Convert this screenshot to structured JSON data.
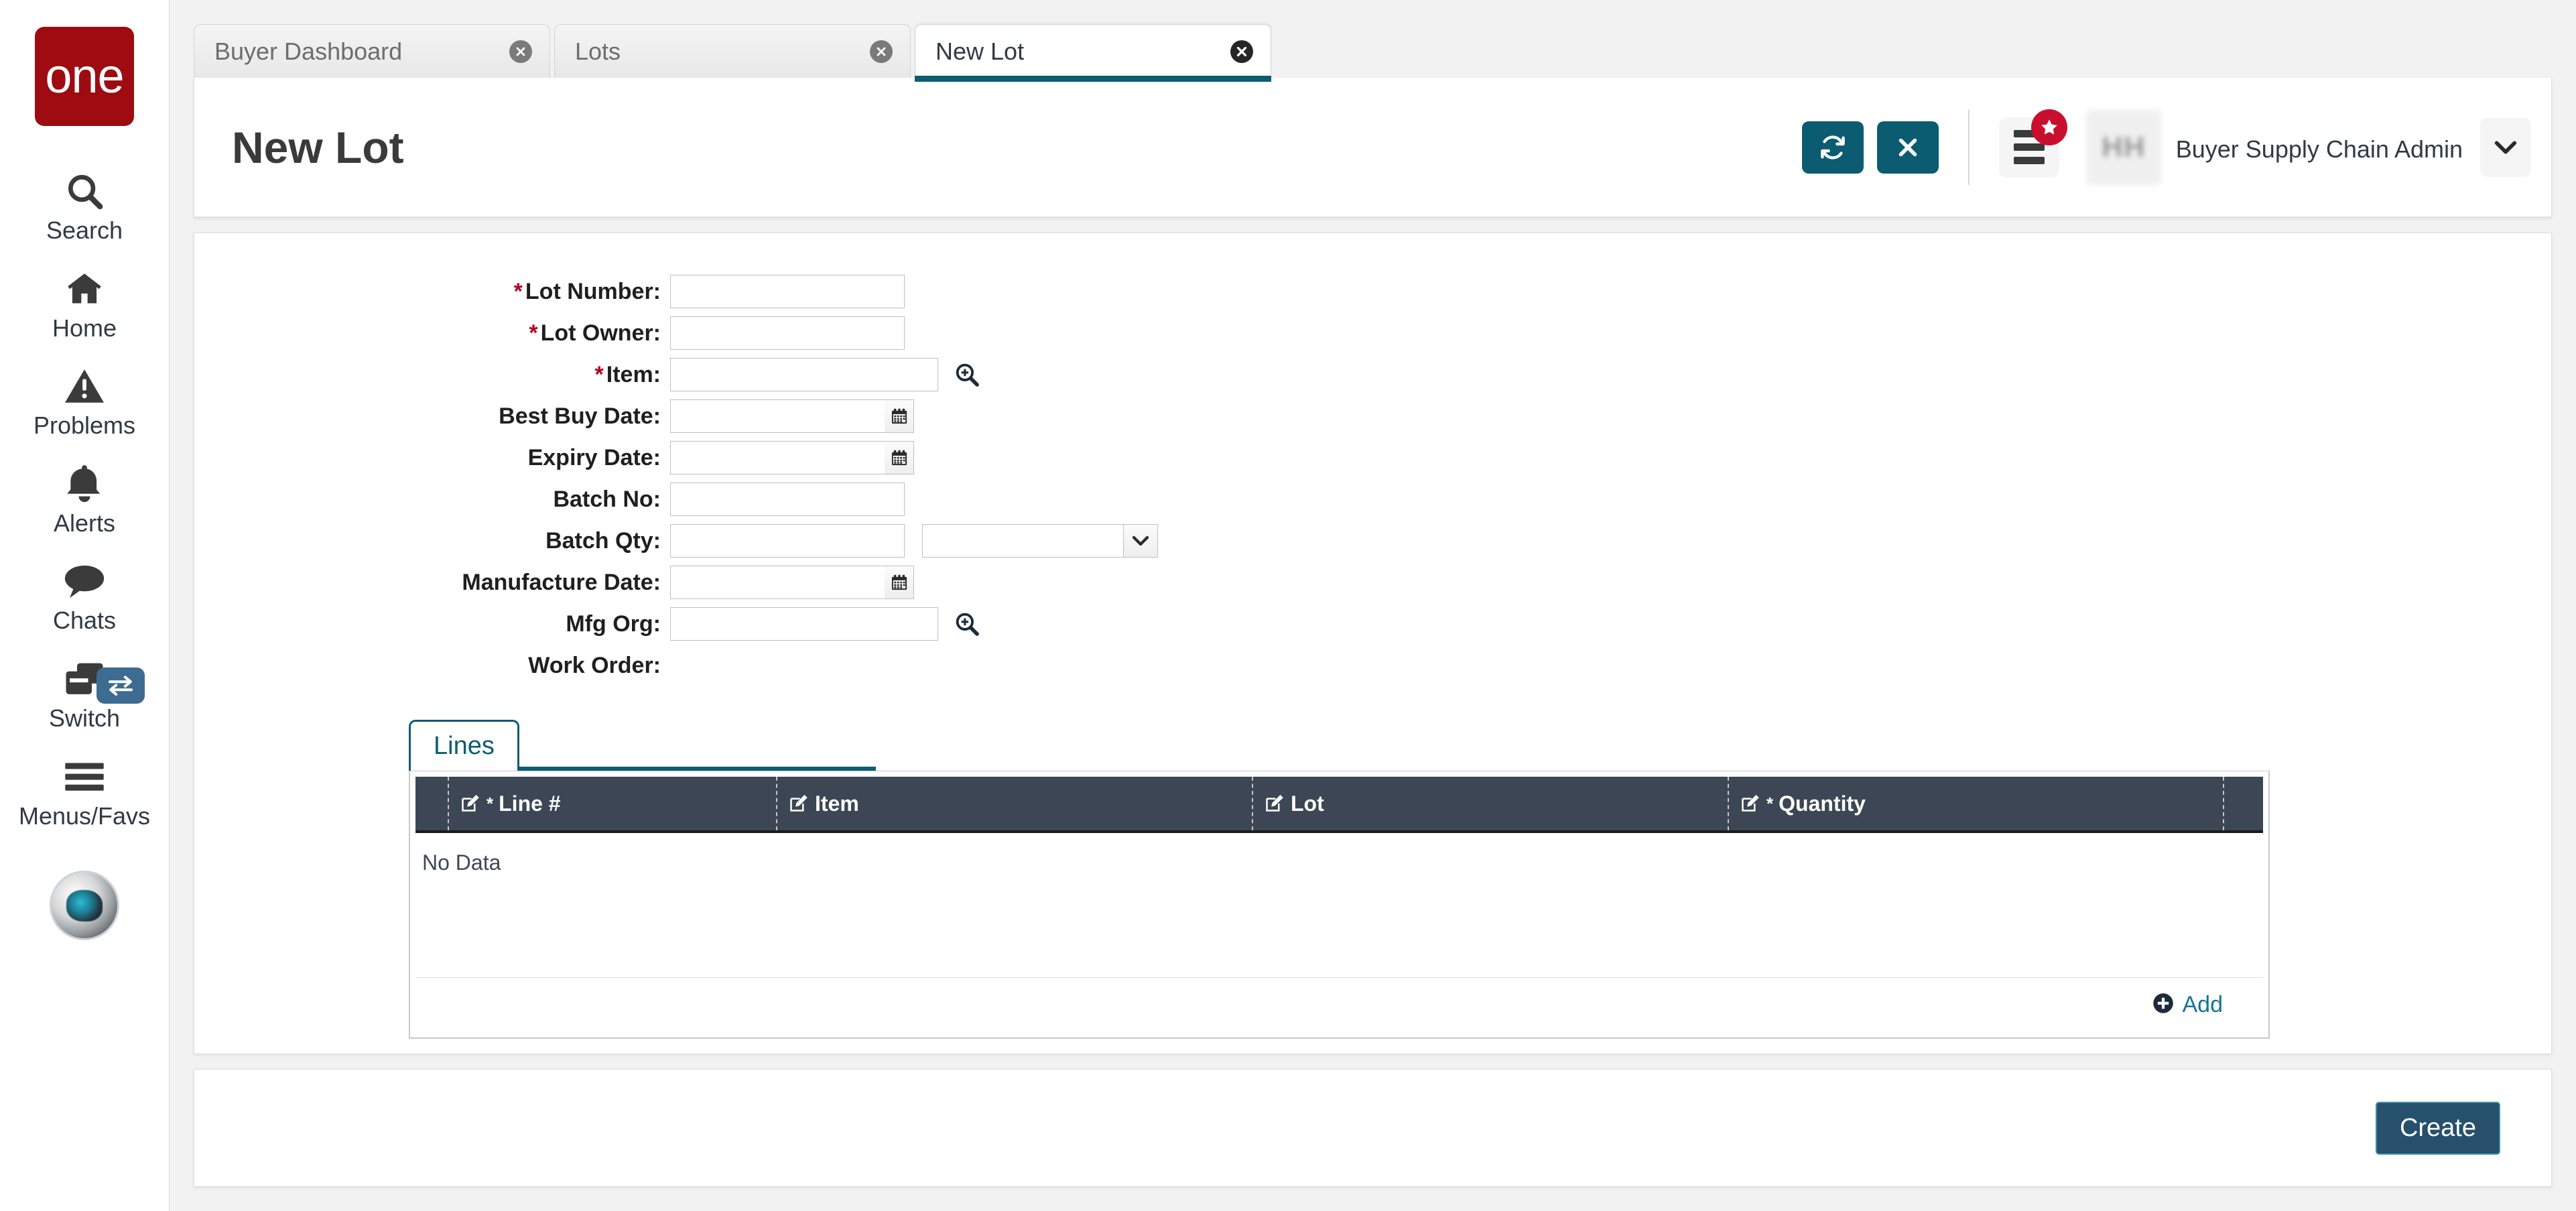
{
  "brand": {
    "logo_text": "one",
    "logo_color": "#9e0b11"
  },
  "sidebar": {
    "items": [
      {
        "label": "Search",
        "icon": "search-icon"
      },
      {
        "label": "Home",
        "icon": "home-icon"
      },
      {
        "label": "Problems",
        "icon": "warning-triangle-icon"
      },
      {
        "label": "Alerts",
        "icon": "bell-icon"
      },
      {
        "label": "Chats",
        "icon": "chat-bubble-icon"
      },
      {
        "label": "Switch",
        "icon": "switch-windows-icon",
        "badge_icon": "exchange-arrows-icon"
      },
      {
        "label": "Menus/Favs",
        "icon": "hamburger-icon"
      }
    ]
  },
  "tabs": [
    {
      "label": "Buyer Dashboard",
      "active": false
    },
    {
      "label": "Lots",
      "active": false
    },
    {
      "label": "New Lot",
      "active": true
    }
  ],
  "header": {
    "title": "New Lot",
    "refresh_icon": "refresh-icon",
    "close_icon": "close-x-icon",
    "menu_icon": "list-menu-icon",
    "star_badge_icon": "star-icon",
    "caret_icon": "chevron-down-icon",
    "user": {
      "avatar_initials": "HH",
      "name": "",
      "role": "Buyer Supply Chain Admin",
      "sub": ""
    }
  },
  "form": {
    "fields": [
      {
        "label": "Lot Number:",
        "required": true,
        "value": "",
        "control": "text"
      },
      {
        "label": "Lot Owner:",
        "required": true,
        "value": "",
        "control": "text"
      },
      {
        "label": "Item:",
        "required": true,
        "value": "",
        "control": "text-search",
        "search_icon": "magnifier-plus-icon"
      },
      {
        "label": "Best Buy Date:",
        "required": false,
        "value": "",
        "control": "date",
        "calendar_icon": "calendar-icon"
      },
      {
        "label": "Expiry Date:",
        "required": false,
        "value": "",
        "control": "date",
        "calendar_icon": "calendar-icon"
      },
      {
        "label": "Batch No:",
        "required": false,
        "value": "",
        "control": "text"
      },
      {
        "label": "Batch Qty:",
        "required": false,
        "value": "",
        "control": "text-select",
        "select_value": "",
        "select_icon": "chevron-down-icon"
      },
      {
        "label": "Manufacture Date:",
        "required": false,
        "value": "",
        "control": "date",
        "calendar_icon": "calendar-icon"
      },
      {
        "label": "Mfg Org:",
        "required": false,
        "value": "",
        "control": "text-search",
        "search_icon": "magnifier-plus-icon"
      },
      {
        "label": "Work Order:",
        "required": false,
        "value": "",
        "control": "none"
      }
    ]
  },
  "lines": {
    "tab_label": "Lines",
    "columns": [
      {
        "label": "Line #",
        "required": true,
        "edit_icon": "edit-pencil-icon"
      },
      {
        "label": "Item",
        "required": false,
        "edit_icon": "edit-pencil-icon"
      },
      {
        "label": "Lot",
        "required": false,
        "edit_icon": "edit-pencil-icon"
      },
      {
        "label": "Quantity",
        "required": true,
        "edit_icon": "edit-pencil-icon"
      }
    ],
    "rows": [],
    "empty_text": "No Data",
    "add_label": "Add",
    "add_icon": "plus-circle-icon"
  },
  "footer": {
    "create_label": "Create"
  },
  "colors": {
    "brand_red": "#9e0b11",
    "teal": "#0b5c71",
    "grid_header": "#3c4654",
    "link_blue": "#14739c",
    "create_bg": "#26506b",
    "create_border": "#3d93a8",
    "required_red": "#b00020"
  }
}
